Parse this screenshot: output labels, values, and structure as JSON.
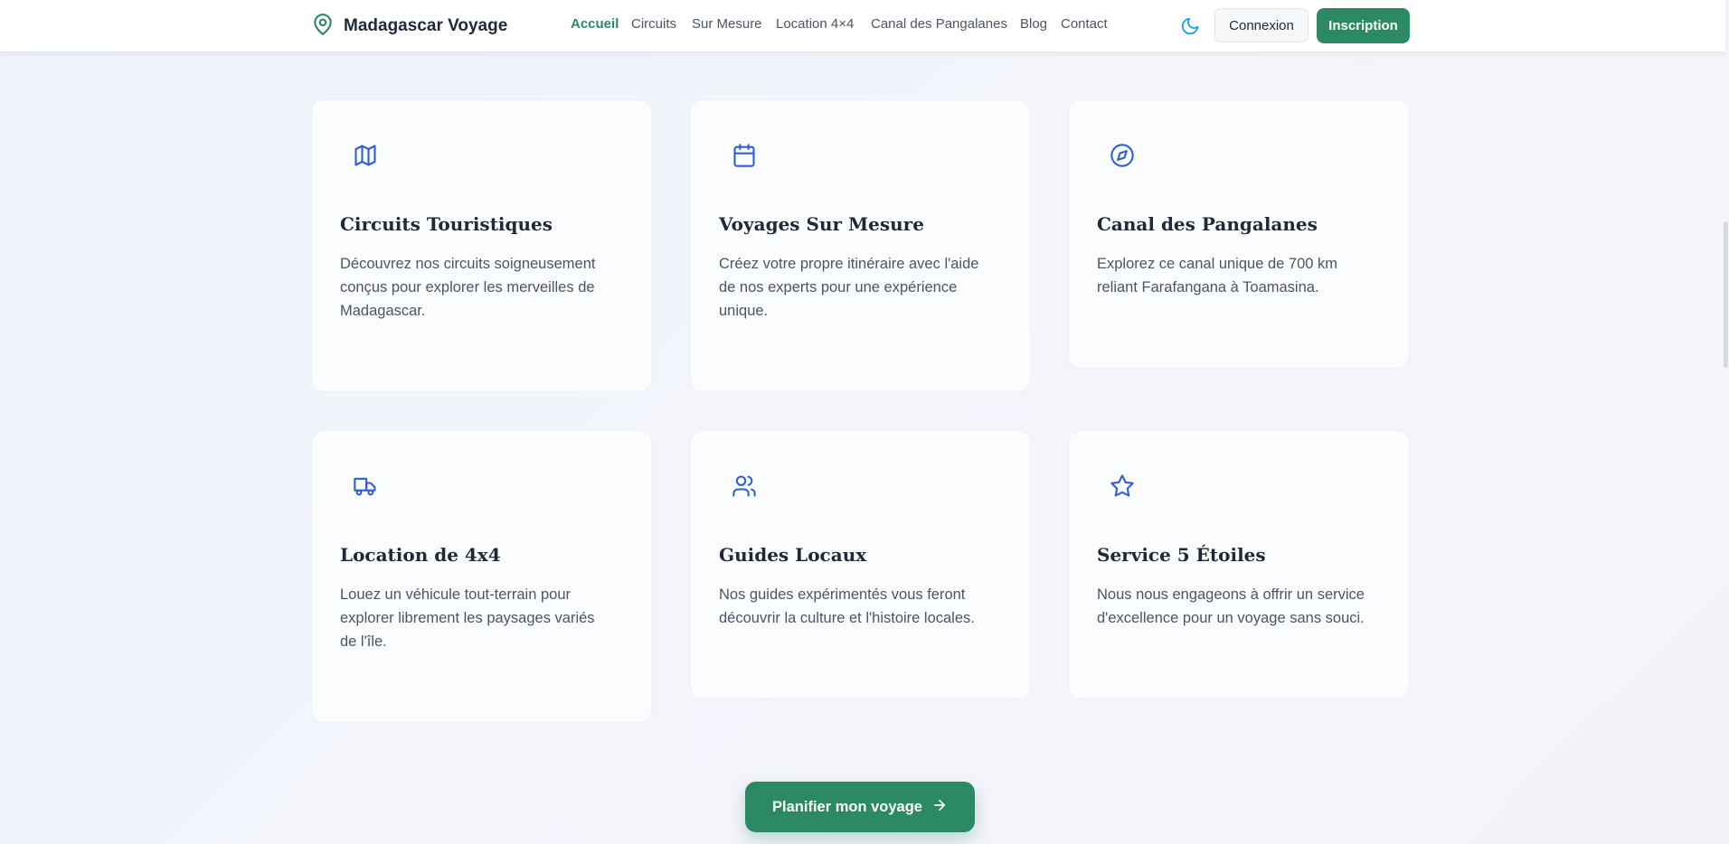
{
  "header": {
    "brand_name": "Madagascar Voyage",
    "nav": [
      {
        "label": "Accueil",
        "active": true
      },
      {
        "label": "Circuits",
        "active": false
      },
      {
        "label": "Sur Mesure",
        "active": false
      },
      {
        "label": "Location 4×4",
        "active": false
      },
      {
        "label": "Canal des Pangalanes",
        "active": false
      },
      {
        "label": "Blog",
        "active": false
      },
      {
        "label": "Contact",
        "active": false
      }
    ],
    "login_label": "Connexion",
    "signup_label": "Inscription"
  },
  "features": [
    {
      "icon": "map-icon",
      "title": "Circuits Touristiques",
      "text": "Découvrez nos circuits soigneusement conçus pour explorer les merveilles de Madagascar."
    },
    {
      "icon": "calendar-icon",
      "title": "Voyages Sur Mesure",
      "text": "Créez votre propre itinéraire avec l'aide de nos experts pour une expérience unique."
    },
    {
      "icon": "compass-icon",
      "title": "Canal des Pangalanes",
      "text": "Explorez ce canal unique de 700 km reliant Farafangana à Toamasina."
    },
    {
      "icon": "truck-icon",
      "title": "Location de 4x4",
      "text": "Louez un véhicule tout-terrain pour explorer librement les paysages variés de l'île."
    },
    {
      "icon": "users-icon",
      "title": "Guides Locaux",
      "text": "Nos guides expérimentés vous feront découvrir la culture et l'histoire locales."
    },
    {
      "icon": "star-icon",
      "title": "Service 5 Étoiles",
      "text": "Nous nous engageons à offrir un service d'excellence pour un voyage sans souci."
    }
  ],
  "cta_label": "Planifier mon voyage",
  "colors": {
    "primary": "#2b8a63",
    "icon_blue": "#2f5fd3",
    "moon_blue": "#0ea5e9"
  }
}
